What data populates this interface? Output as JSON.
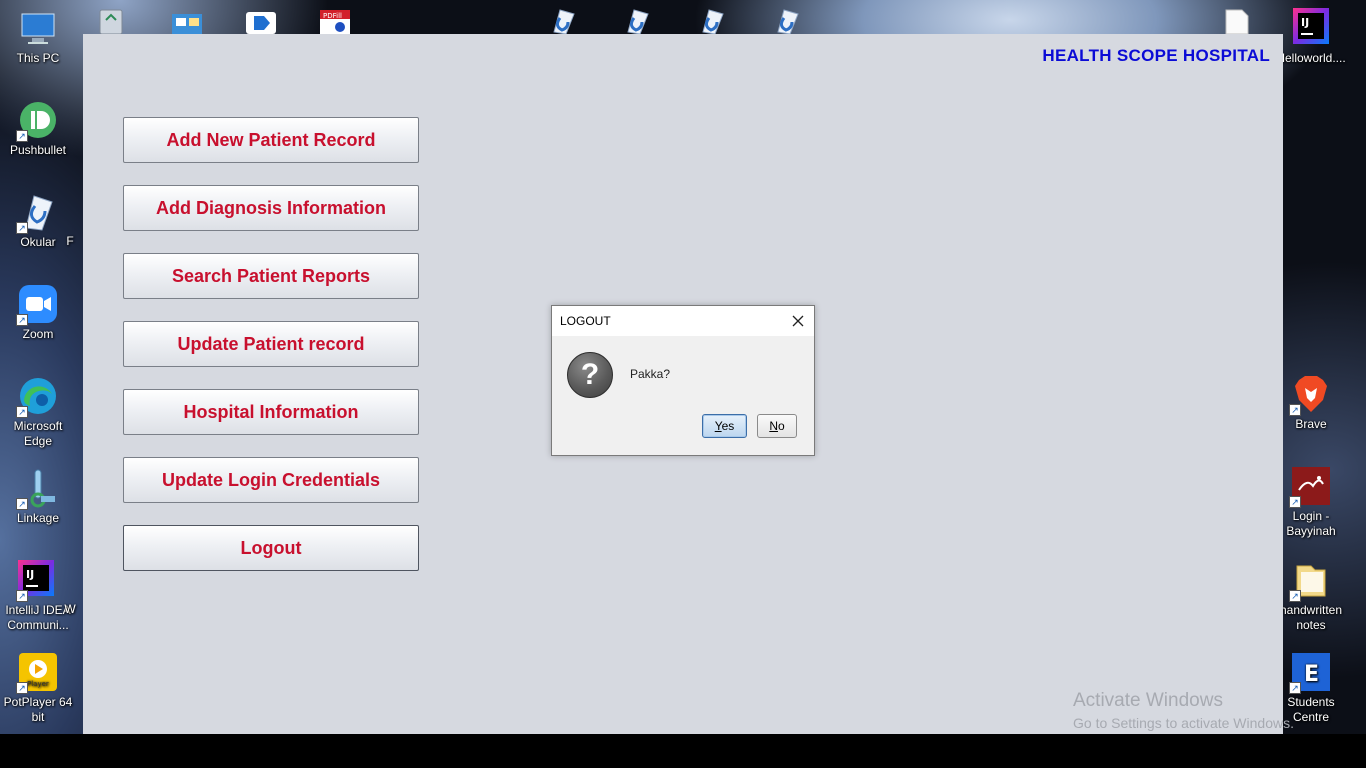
{
  "desktop": {
    "left_icons": [
      {
        "label": "This PC",
        "icon": "this-pc-icon",
        "color": "#2b7cd3"
      },
      {
        "label": "Pushbullet",
        "icon": "pushbullet-icon",
        "color": "#4ab367"
      },
      {
        "label": "Okular",
        "icon": "okular-icon",
        "color": "#e8eef6"
      },
      {
        "label": "Zoom",
        "icon": "zoom-icon",
        "color": "#2d8cff"
      },
      {
        "label": "Microsoft Edge",
        "icon": "edge-icon",
        "color": "#1f9fd9"
      },
      {
        "label": "Linkage",
        "icon": "linkage-icon",
        "color": "#9fd0f0"
      },
      {
        "label": "IntelliJ IDEA Communi...",
        "icon": "intellij-icon",
        "color": "#1b1b2f"
      },
      {
        "label": "PotPlayer 64 bit",
        "icon": "potplayer-icon",
        "color": "#f5c400"
      }
    ],
    "right_icons": [
      {
        "label": "Helloworld....",
        "icon": "intellij-file-icon",
        "color": "#1b1b2f"
      },
      {
        "label": "Brave",
        "icon": "brave-icon",
        "color": "#f04a23"
      },
      {
        "label": "Login - Bayyinah",
        "icon": "bayyinah-icon",
        "color": "#8c1a1a"
      },
      {
        "label": "handwritten notes",
        "icon": "folder-icon",
        "color": "#f2d98a"
      },
      {
        "label": "Students Centre",
        "icon": "students-centre-icon",
        "color": "#1e63d6"
      }
    ],
    "partial_labels": [
      "F",
      "W"
    ],
    "watermark_title": "Activate Windows",
    "watermark_sub": "Go to Settings to activate Windows."
  },
  "app": {
    "title": "HEALTH SCOPE HOSPITAL",
    "menu": [
      "Add New Patient Record",
      "Add Diagnosis Information",
      "Search Patient Reports",
      "Update Patient record",
      "Hospital Information",
      "Update Login Credentials",
      "Logout"
    ]
  },
  "dialog": {
    "title": "LOGOUT",
    "message": "Pakka?",
    "yes_mnemonic": "Y",
    "yes_rest": "es",
    "no_mnemonic": "N",
    "no_rest": "o",
    "icon": "question-icon"
  }
}
